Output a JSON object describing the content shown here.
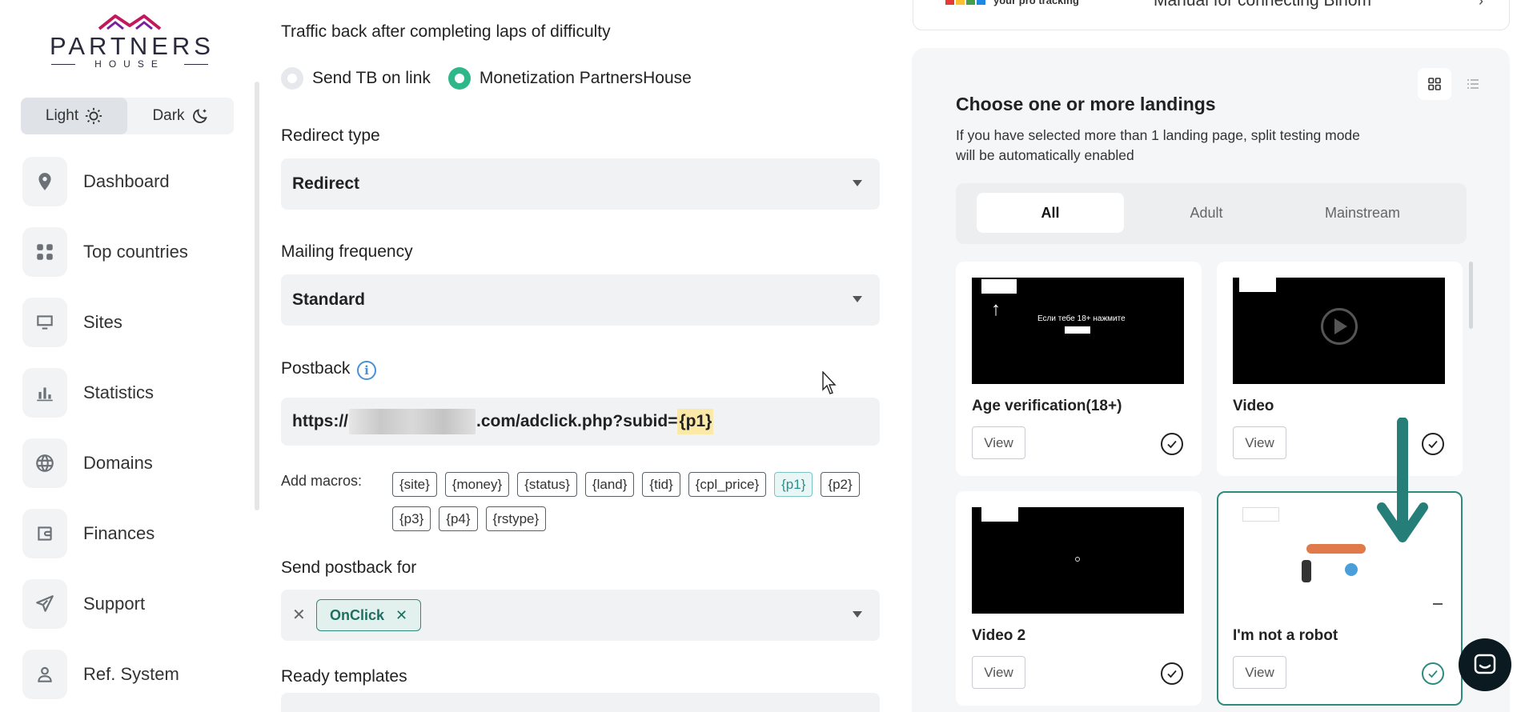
{
  "brand": {
    "name": "PARTNERS",
    "sub": "HOUSE"
  },
  "theme": {
    "light_label": "Light",
    "dark_label": "Dark"
  },
  "nav": [
    {
      "label": "Dashboard",
      "icon": "map-pin-icon"
    },
    {
      "label": "Top countries",
      "icon": "grid-icon"
    },
    {
      "label": "Sites",
      "icon": "monitor-icon"
    },
    {
      "label": "Statistics",
      "icon": "bar-chart-icon"
    },
    {
      "label": "Domains",
      "icon": "globe-icon"
    },
    {
      "label": "Finances",
      "icon": "wallet-icon"
    },
    {
      "label": "Support",
      "icon": "paper-plane-icon"
    },
    {
      "label": "Ref. System",
      "icon": "user-icon"
    }
  ],
  "form": {
    "traffic_back_label": "Traffic back after completing laps of difficulty",
    "radio_options": [
      "Send TB on link",
      "Monetization PartnersHouse"
    ],
    "redirect_type_label": "Redirect type",
    "redirect_type_value": "Redirect",
    "mailing_label": "Mailing frequency",
    "mailing_value": "Standard",
    "postback_label": "Postback",
    "postback_prefix": "https://",
    "postback_suffix": ".com/adclick.php?subid=",
    "postback_macro": "{p1}",
    "macros_label": "Add macros:",
    "macros": [
      "{site}",
      "{money}",
      "{status}",
      "{land}",
      "{tid}",
      "{cpl_price}",
      "{p1}",
      "{p2}",
      "{p3}",
      "{p4}",
      "{rstype}"
    ],
    "selected_macro": "{p1}",
    "send_for_label": "Send postback for",
    "send_for_chip": "OnClick",
    "templates_label": "Ready templates"
  },
  "top_card": {
    "tag": "your pro tracking",
    "text": "Manual for connecting Binom"
  },
  "landings": {
    "title": "Choose one or more landings",
    "description": "If you have selected more than 1 landing page, split testing mode will be automatically enabled",
    "tabs": [
      "All",
      "Adult",
      "Mainstream"
    ],
    "active_tab": "All",
    "cards": [
      {
        "title": "Age verification(18+)",
        "button": "View",
        "thumb_text": "Если тебе 18+ нажмите",
        "selected": false
      },
      {
        "title": "Video",
        "button": "View",
        "selected": false
      },
      {
        "title": "Video 2",
        "button": "View",
        "selected": false
      },
      {
        "title": "I'm not a robot",
        "button": "View",
        "selected": true
      }
    ]
  },
  "colors": {
    "accent": "#2fb78a",
    "selected_border": "#2e8a7e",
    "arrow": "#267e78"
  }
}
